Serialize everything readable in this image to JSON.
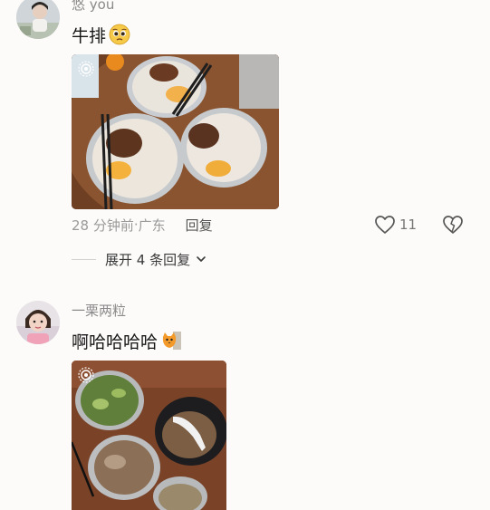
{
  "comments": [
    {
      "username": "悠 you",
      "text": "牛排",
      "emoji": "pleading-face-emoji",
      "meta": {
        "time": "28 分钟前",
        "separator": " · ",
        "location": "广东",
        "reply_label": "回复"
      },
      "likes": "11",
      "expand_label": "展开 4 条回复"
    },
    {
      "username": "一栗两粒",
      "text": "啊哈哈哈哈",
      "emoji": "cat-sticker-emoji"
    }
  ],
  "icons": {
    "like": "heart-outline-icon",
    "dislike": "broken-heart-icon",
    "live_photo": "live-photo-icon",
    "expand": "chevron-down-icon"
  },
  "colors": {
    "background": "#fcfbf9",
    "username": "#8a8a8a",
    "meta": "#9a9a9a"
  }
}
